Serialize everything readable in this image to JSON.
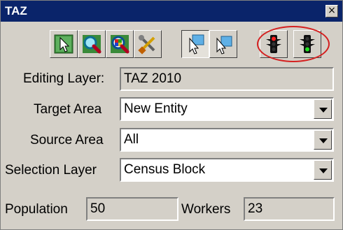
{
  "window": {
    "title": "TAZ",
    "close_glyph": "×"
  },
  "toolbar": {
    "buttons": [
      {
        "icon": "select-pointer-icon",
        "pressed": false
      },
      {
        "icon": "zoom-magnifier-icon",
        "pressed": false
      },
      {
        "icon": "zoom-color-magnifier-icon",
        "pressed": false
      },
      {
        "icon": "tools-icon",
        "pressed": false
      },
      {
        "icon": "pointer-add-icon",
        "pressed": true
      },
      {
        "icon": "pointer-select-icon",
        "pressed": false
      },
      {
        "icon": "traffic-light-red-icon",
        "pressed": false
      },
      {
        "icon": "traffic-light-green-icon",
        "pressed": false
      }
    ],
    "highlight_color": "#d42020"
  },
  "form": {
    "editing_layer": {
      "label": "Editing Layer:",
      "value": "TAZ 2010"
    },
    "target_area": {
      "label": "Target Area",
      "value": "New Entity"
    },
    "source_area": {
      "label": "Source Area",
      "value": "All"
    },
    "selection_layer": {
      "label": "Selection Layer",
      "value": "Census Block"
    },
    "population": {
      "label": "Population",
      "value": "50"
    },
    "workers": {
      "label": "Workers",
      "value": "23"
    }
  }
}
